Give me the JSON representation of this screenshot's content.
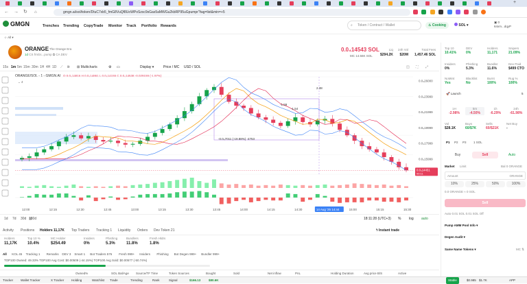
{
  "browser": {
    "url": "gmgn.ai/sol/token/DtuC7xb5_fmG8VuQf8UoWPoSzsc9sGas5aMWGu2kbRP95uGpumpr?tag=list&min=+5",
    "add_tab": "+"
  },
  "app": {
    "logo": "GMGN",
    "nav": [
      "Trenches",
      "Trending",
      "CopyTrade",
      "Monitor",
      "Track",
      "Portfolio",
      "Rewards"
    ],
    "search_placeholder": "Token / Contract / Wallet",
    "cooking": "Cooking",
    "chain": "SOL",
    "account_balance": "0",
    "account_name": "64xm...dqyP",
    "sub_all": "All"
  },
  "token": {
    "symbol": "ORANGE",
    "name": "The Orange Era",
    "age": "1d",
    "holders_short": "CS",
    "platform": "fmGs...pump",
    "ca": "CA",
    "dev": "DEV",
    "price": "0.0₄14543 SOL",
    "mc_line": "MC  14.56K  SOL",
    "stats": [
      {
        "label": "Liq",
        "value": "$294.2K"
      },
      {
        "label": "24h Vol",
        "value": "$20M"
      },
      {
        "label": "Total Fees",
        "value": "1,457.46 SOL"
      }
    ]
  },
  "chart_toolbar": {
    "intervals": [
      "15s",
      "1m",
      "5m",
      "15m",
      "30m",
      "1H",
      "4H",
      "1D"
    ],
    "multicharts": "Multicharts",
    "display": "Display",
    "price_mc": "Price / MC",
    "usd_sol": "USD / SOL"
  },
  "chart_header": {
    "pair": "ORANGE/SOL - 1 - GMGN.AI",
    "ohlc": "O 0.0₄14816  H 0.0₄14861  L 0.0₄14155  C 0.0₄14538  -0.029159 (-1.97%)",
    "indicator_count": "4"
  },
  "chart_data": {
    "type": "candlestick",
    "x_ticks": [
      "12:00",
      "12:15",
      "12:30",
      "12:45",
      "13:00",
      "13:15",
      "13:30",
      "13:45",
      "14:00",
      "14:15",
      "14:30",
      "14 Aug '25  14:44",
      "15:00",
      "15:15",
      "15:30"
    ],
    "y_ticks": [
      "0.0₄26000",
      "0.0₄23999",
      "0.0₄21999",
      "0.0₄19999",
      "0.0₄17999",
      "0.0₄15999"
    ],
    "ylim": [
      1.4e-05,
      2.6e-05
    ],
    "current_price_label": "0.0₄14451",
    "current_price_sub": "00:11",
    "annotations": [
      "-0.0₄7011 (-19.88%) -4753",
      "2.38",
      "-1.59",
      "-1.54"
    ],
    "closes": [
      16.1,
      16.3,
      16.8,
      17.2,
      17.6,
      18.2,
      18.8,
      19.0,
      18.6,
      18.9,
      18.4,
      18.2,
      18.3,
      18.0,
      17.8,
      17.9,
      18.3,
      18.8,
      19.3,
      19.8,
      20.4,
      21.2,
      22.1,
      23.0,
      24.0,
      24.8,
      25.2,
      24.2,
      23.3,
      22.8,
      22.5,
      21.8,
      21.3,
      21.0,
      20.6,
      20.2,
      20.8,
      21.3,
      20.7,
      20.4,
      20.9,
      21.1,
      20.5,
      19.7,
      19.0,
      18.3,
      17.6,
      17.2,
      16.8,
      16.2,
      15.6,
      14.9,
      14.5
    ],
    "volume": [
      3,
      2,
      4,
      5,
      3,
      2,
      4,
      6,
      3,
      2,
      3,
      2,
      3,
      4,
      3,
      5,
      6,
      7,
      9,
      10,
      12,
      14,
      16,
      18,
      12,
      9,
      15,
      8,
      6,
      7,
      5,
      6,
      4,
      5,
      4,
      6,
      5,
      4,
      5,
      4,
      5,
      6,
      4,
      5,
      6,
      8,
      7,
      6,
      5,
      6,
      4,
      5,
      3
    ]
  },
  "chart_bottom": {
    "ranges": [
      "1d",
      "7d",
      "30d",
      "180d"
    ],
    "clock": "18:11:28 (UTC+3)",
    "pct": "%",
    "log": "log",
    "auto": "auto"
  },
  "holders_tabs": {
    "items": [
      "Activity",
      "Positions",
      "Holders 11,17K",
      "Top Traders",
      "Tracking 1",
      "Liquidity",
      "Orders",
      "Dev Token 21"
    ],
    "instant_trade": "Instant trade"
  },
  "holder_stats": [
    {
      "label": "Holders",
      "value": "11,17K"
    },
    {
      "label": "Top 10 %",
      "value": "10.4%"
    },
    {
      "label": "MC Holder",
      "value": "$254.49"
    },
    {
      "label": "Insiders",
      "value": "0%"
    },
    {
      "label": "Phishing",
      "value": "5.3%"
    },
    {
      "label": "Bundlers",
      "value": "11.8%"
    },
    {
      "label": "Fresh Hldrs",
      "value": "1.8%"
    }
  ],
  "filters": [
    "All",
    "KOL 45",
    "Tracking 1",
    "Remarks",
    "DEV 3",
    "Smart 1",
    "Bot Traders 576",
    "Fresh 999+",
    "Insiders",
    "Phishing",
    "Bot Degen 999+",
    "Bundler 999+"
  ],
  "progress_text": "TOP100 Owned: 49.33%  TOP100 Avg Cost: $0.00509 (-44.15%)  TOP100 Avg Sold: $0.00577 (-50.74%)",
  "table_head": [
    "Owned%",
    "SOL Bal/Age",
    "Source/TF Time",
    "Token Sources",
    "Bought",
    "Sold",
    "Net inflow",
    "PnL",
    "Holding Duration",
    "Avg price B/S",
    "Active"
  ],
  "taskbar": [
    "Tracker",
    "Wallet Tracker",
    "X Tracker",
    "Holding",
    "Watchlist",
    "Trade",
    "Trending",
    "Rank",
    "Signal",
    "$166.13",
    "$80.6K"
  ],
  "taskbar_right": [
    "Stable",
    "$0.985",
    "$1.7K",
    "APP"
  ],
  "right_panel": {
    "top": [
      {
        "label": "Top 10",
        "value": "10.41%"
      },
      {
        "label": "DEV",
        "value": "0%"
      },
      {
        "label": "Holders",
        "value": "11,171"
      },
      {
        "label": "Snipers",
        "value": "21.09%"
      }
    ],
    "mid": [
      {
        "label": "Insiders",
        "value": "0%"
      },
      {
        "label": "Phishing",
        "value": "5.3%"
      },
      {
        "label": "Bundler",
        "value": "11.6%"
      },
      {
        "label": "Dev Paid",
        "value": "$499 CTO"
      }
    ],
    "security": [
      {
        "label": "NoMint",
        "value": "Yes"
      },
      {
        "label": "Blacklist",
        "value": "No"
      },
      {
        "label": "Burnt",
        "value": "100%"
      },
      {
        "label": "Rug %",
        "value": "100%"
      }
    ],
    "launch": "Launch",
    "launch_val": "5",
    "timeframes": [
      {
        "label": "1H",
        "value": "-2.98%"
      },
      {
        "label": "5m",
        "value": "-4.50%"
      },
      {
        "label": "1h",
        "value": "-6.29%"
      },
      {
        "label": "24h",
        "value": "-61.98%"
      }
    ],
    "volrow": [
      {
        "label": "Vol",
        "value": "$28.1K"
      },
      {
        "label": "Buys",
        "value": "60/$7K"
      },
      {
        "label": "Sells",
        "value": "60/$21K"
      },
      {
        "label": "Net Buy",
        "value": "-"
      }
    ],
    "presets": [
      "P1",
      "P2",
      "P3"
    ],
    "preset_extra": "1 SOL",
    "buy": "Buy",
    "sell": "Sell",
    "auto": "Auto",
    "market": "Market",
    "limit": "Limit",
    "bal": "Bal 0 ORANGE",
    "amount_label": "Amount",
    "amount_unit": "ORANGE",
    "pcts": [
      "10%",
      "25%",
      "50%",
      "100%"
    ],
    "summary": "0.0 ORANGE ≈ 0 SOL",
    "sell_btn": "Sell",
    "fees": "Auto  0.01 SOL  0.01 SOL  Off",
    "pool_info": "Pump AMM Pool Info",
    "degen_audit": "Degen Audit",
    "same_name": "Same Name Tokens",
    "mc": "MC"
  },
  "colors": {
    "up": "#16a34a",
    "down": "#e53e5b",
    "accent": "#1f8f3a"
  }
}
